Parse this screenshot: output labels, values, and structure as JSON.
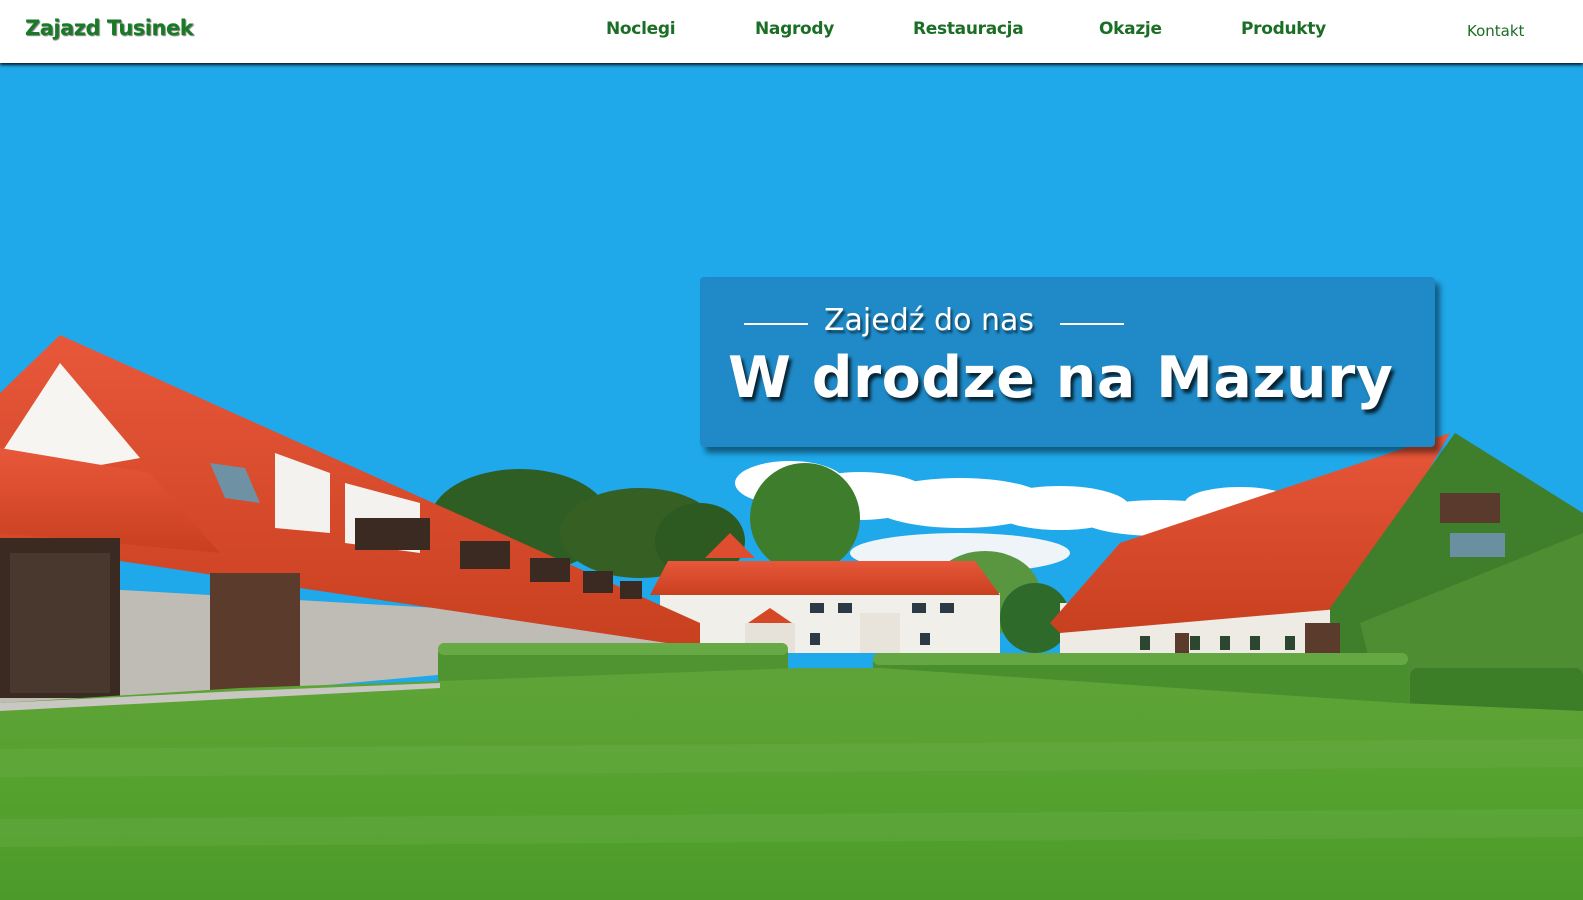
{
  "header": {
    "logo": "Zajazd Tusinek",
    "nav": [
      {
        "label": "Noclegi"
      },
      {
        "label": "Nagrody"
      },
      {
        "label": "Restauracja"
      },
      {
        "label": "Okazje"
      },
      {
        "label": "Produkty"
      }
    ],
    "contact": "Kontakt"
  },
  "hero": {
    "subtitle": "Zajedź do nas",
    "title": "W drodze na Mazury"
  },
  "colors": {
    "brand_green": "#1b6e25",
    "sky": "#1fa8ea",
    "card": "#1f8ac7"
  }
}
